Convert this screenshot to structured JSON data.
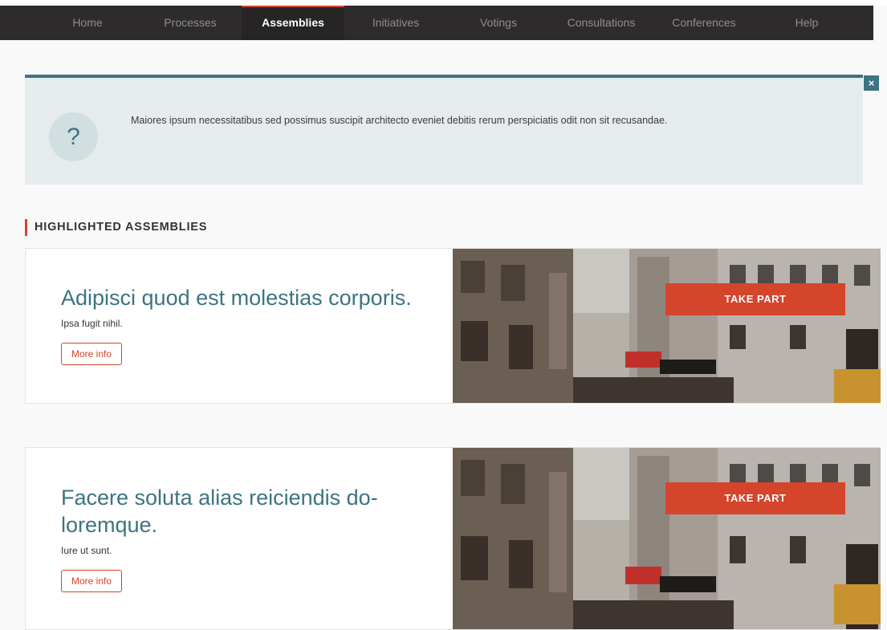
{
  "nav": {
    "items": [
      {
        "label": "Home"
      },
      {
        "label": "Processes"
      },
      {
        "label": "Assemblies"
      },
      {
        "label": "Initiatives"
      },
      {
        "label": "Votings"
      },
      {
        "label": "Consultations"
      },
      {
        "label": "Conferences"
      },
      {
        "label": "Help"
      }
    ],
    "active": "Assemblies"
  },
  "callout": {
    "icon": "question-mark",
    "icon_glyph": "?",
    "text": "Maiores ipsum necessitatibus sed possimus suscipit architecto eveniet debitis rerum perspiciatis odit non sit recusandae.",
    "close_glyph": "×"
  },
  "section": {
    "title": "HIGHLIGHTED ASSEMBLIES"
  },
  "cards": [
    {
      "title": "Adipisci quod est molestias corporis.",
      "subtitle": "Ipsa fugit nihil.",
      "more_label": "More info",
      "cta_label": "TAKE PART",
      "image": "paris-street-photo"
    },
    {
      "title": "Facere soluta alias reiciendis do-loremque.",
      "subtitle": "Iure ut sunt.",
      "more_label": "More info",
      "cta_label": "TAKE PART",
      "image": "paris-street-photo"
    }
  ],
  "colors": {
    "accent": "#d4452c",
    "primary": "#3c7481",
    "topbar": "#2d2b2c"
  }
}
